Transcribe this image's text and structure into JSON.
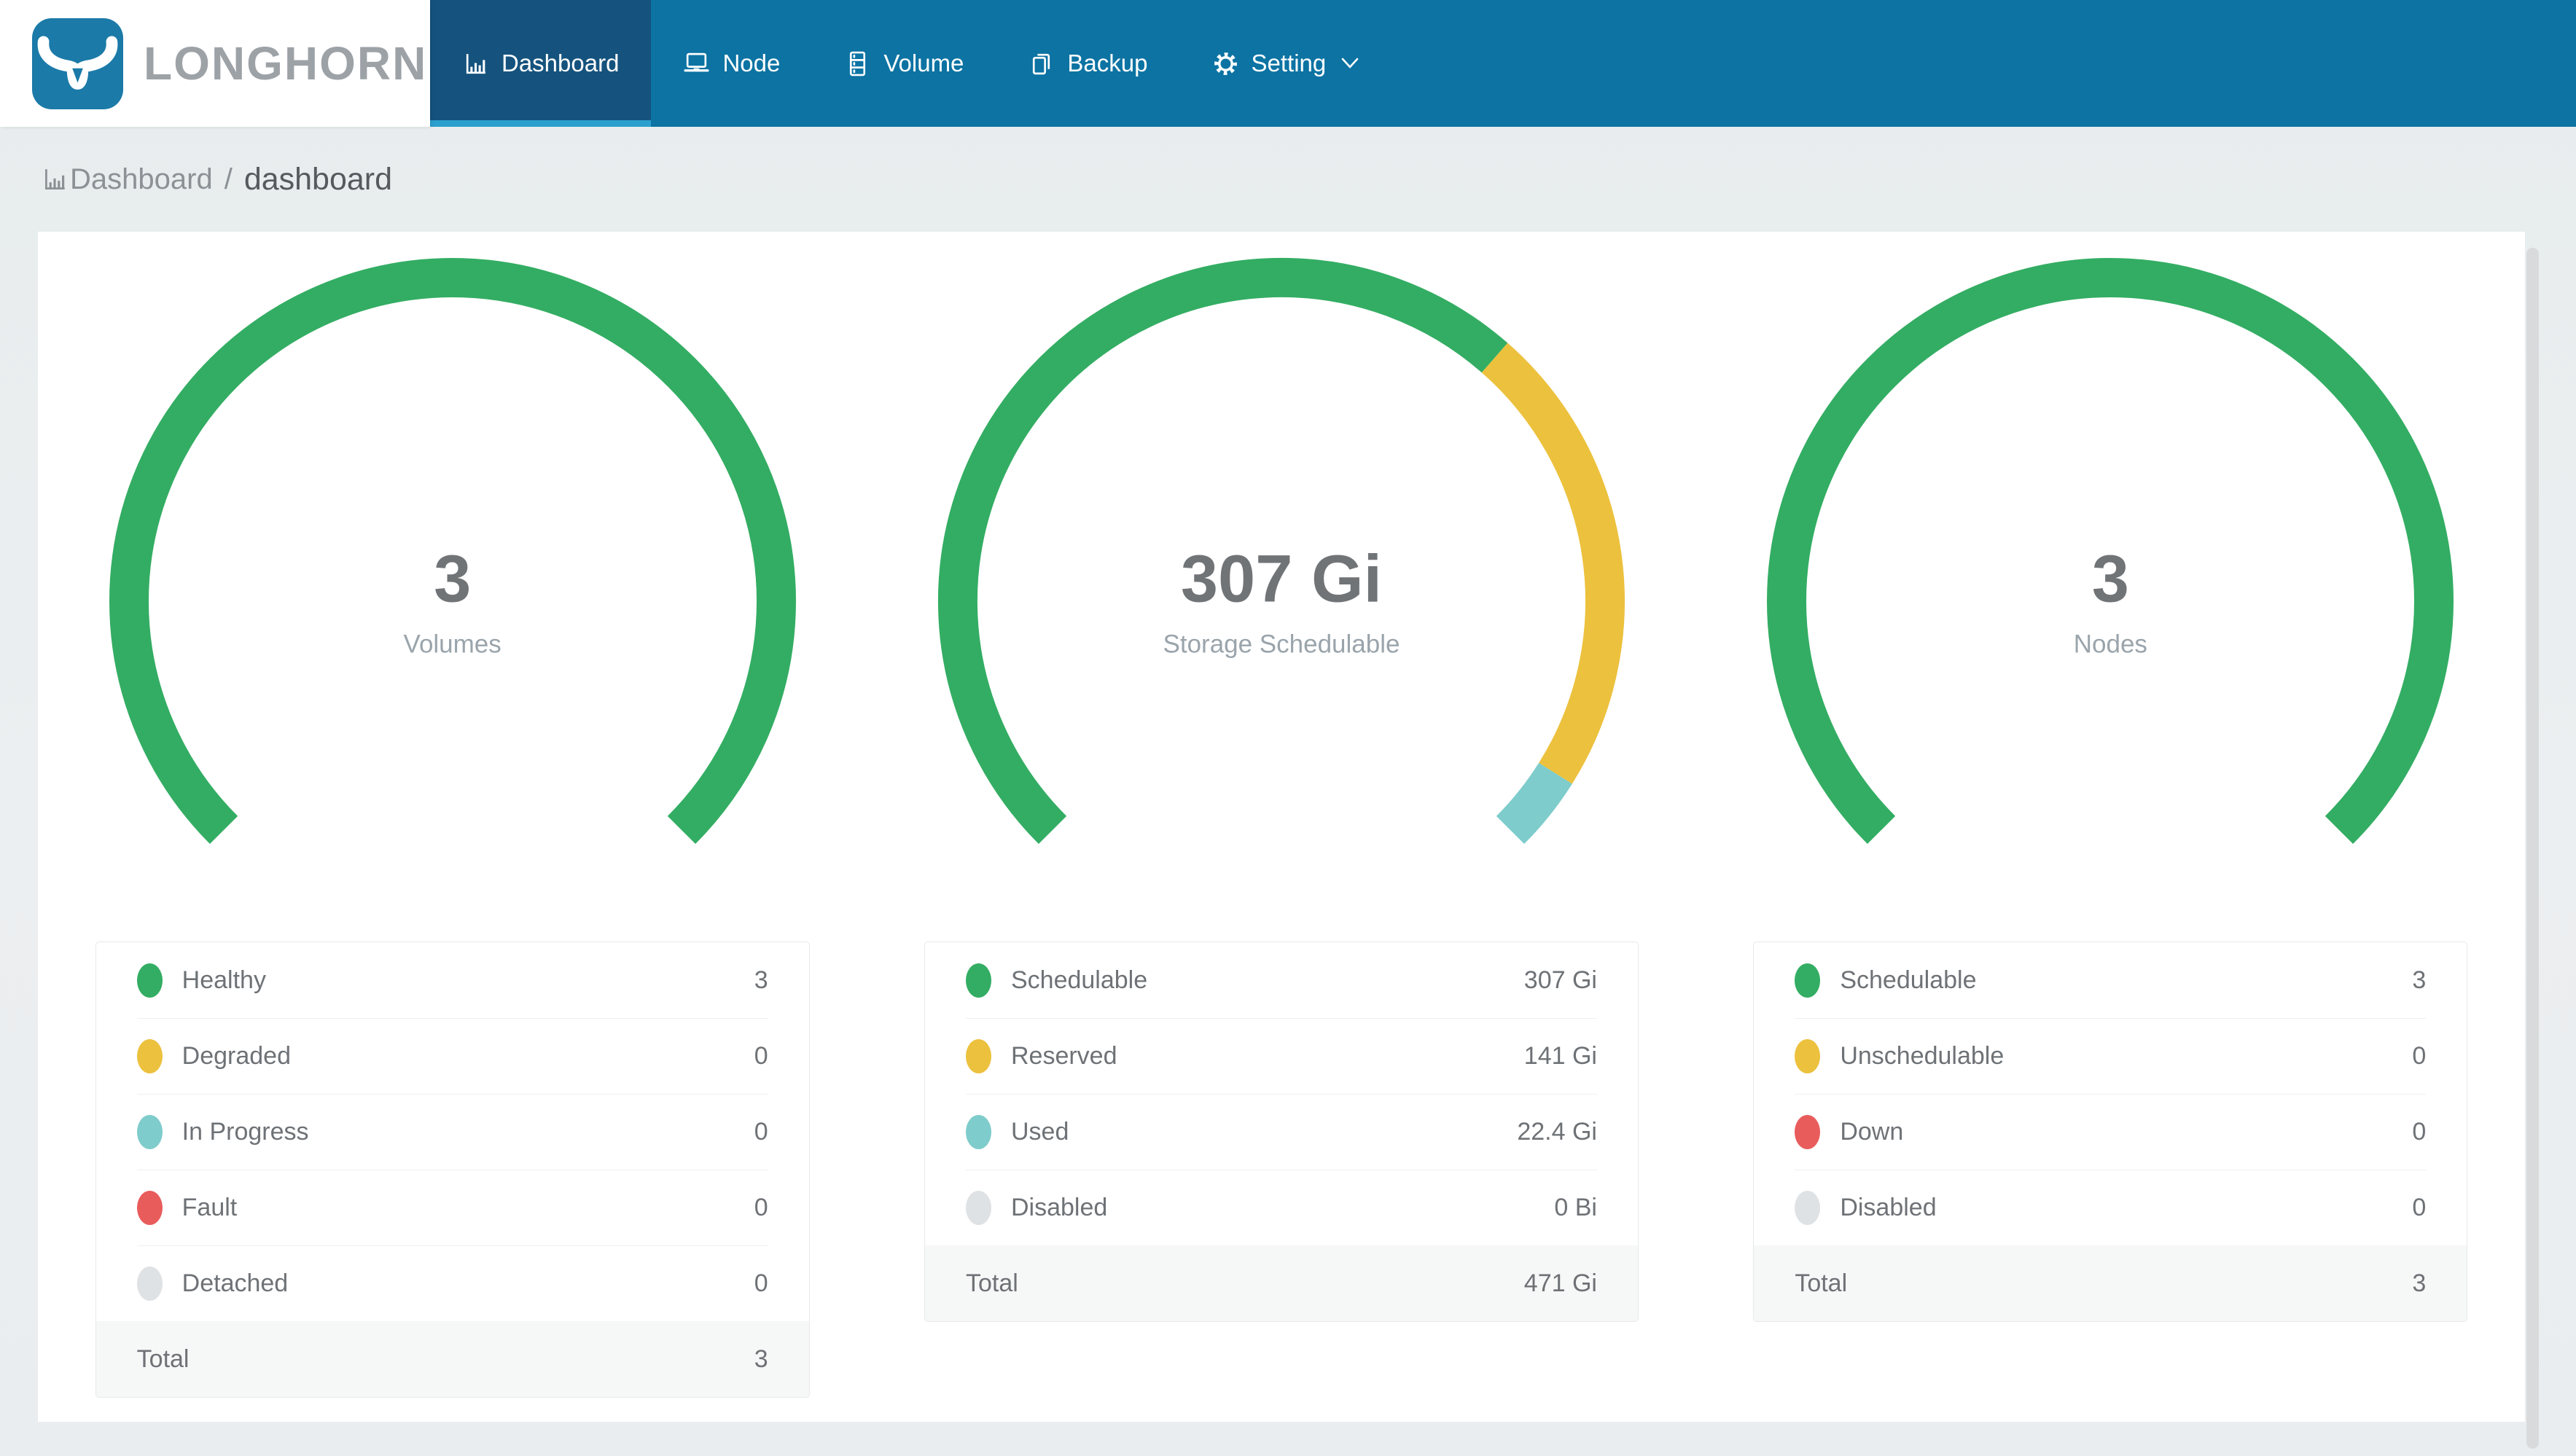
{
  "header": {
    "brand": "LONGHORN",
    "nav_items": [
      {
        "label": "Dashboard",
        "icon": "bar-chart-icon",
        "active": true
      },
      {
        "label": "Node",
        "icon": "laptop-icon",
        "active": false
      },
      {
        "label": "Volume",
        "icon": "server-icon",
        "active": false
      },
      {
        "label": "Backup",
        "icon": "copy-icon",
        "active": false
      },
      {
        "label": "Setting",
        "icon": "gear-icon",
        "active": false,
        "dropdown": true
      }
    ]
  },
  "breadcrumb": {
    "section": "Dashboard",
    "separator": "/",
    "page": "dashboard"
  },
  "panels": [
    {
      "id": "volumes",
      "center_value": "3",
      "center_label": "Volumes",
      "rows": [
        {
          "label": "Healthy",
          "value": "3",
          "color": "#33ad63"
        },
        {
          "label": "Degraded",
          "value": "0",
          "color": "#ecc13d"
        },
        {
          "label": "In Progress",
          "value": "0",
          "color": "#7ecccb"
        },
        {
          "label": "Fault",
          "value": "0",
          "color": "#e95c5c"
        },
        {
          "label": "Detached",
          "value": "0",
          "color": "#dfe2e4"
        }
      ],
      "total": {
        "label": "Total",
        "value": "3"
      },
      "ring": [
        {
          "color": "#33ad63",
          "value": 3
        },
        {
          "color": "#ecc13d",
          "value": 0
        },
        {
          "color": "#7ecccb",
          "value": 0
        },
        {
          "color": "#e95c5c",
          "value": 0
        },
        {
          "color": "#dfe2e4",
          "value": 0
        }
      ]
    },
    {
      "id": "storage",
      "center_value": "307 Gi",
      "center_label": "Storage Schedulable",
      "rows": [
        {
          "label": "Schedulable",
          "value": "307 Gi",
          "color": "#33ad63"
        },
        {
          "label": "Reserved",
          "value": "141 Gi",
          "color": "#ecc13d"
        },
        {
          "label": "Used",
          "value": "22.4 Gi",
          "color": "#7ecccb"
        },
        {
          "label": "Disabled",
          "value": "0 Bi",
          "color": "#dfe2e4"
        }
      ],
      "total": {
        "label": "Total",
        "value": "471 Gi"
      },
      "ring": [
        {
          "color": "#33ad63",
          "value": 307
        },
        {
          "color": "#ecc13d",
          "value": 141
        },
        {
          "color": "#7ecccb",
          "value": 22.4
        },
        {
          "color": "#dfe2e4",
          "value": 0
        }
      ]
    },
    {
      "id": "nodes",
      "center_value": "3",
      "center_label": "Nodes",
      "rows": [
        {
          "label": "Schedulable",
          "value": "3",
          "color": "#33ad63"
        },
        {
          "label": "Unschedulable",
          "value": "0",
          "color": "#ecc13d"
        },
        {
          "label": "Down",
          "value": "0",
          "color": "#e95c5c"
        },
        {
          "label": "Disabled",
          "value": "0",
          "color": "#dfe2e4"
        }
      ],
      "total": {
        "label": "Total",
        "value": "3"
      },
      "ring": [
        {
          "color": "#33ad63",
          "value": 3
        },
        {
          "color": "#ecc13d",
          "value": 0
        },
        {
          "color": "#e95c5c",
          "value": 0
        },
        {
          "color": "#dfe2e4",
          "value": 0
        }
      ]
    }
  ],
  "chart_data": [
    {
      "type": "gauge",
      "title": "Volumes",
      "center_text": "3",
      "center_label": "Volumes",
      "start_angle": 225,
      "end_angle": -45,
      "segments": [
        {
          "name": "Healthy",
          "value": 3,
          "color": "#33ad63"
        },
        {
          "name": "Degraded",
          "value": 0,
          "color": "#ecc13d"
        },
        {
          "name": "In Progress",
          "value": 0,
          "color": "#7ecccb"
        },
        {
          "name": "Fault",
          "value": 0,
          "color": "#e95c5c"
        },
        {
          "name": "Detached",
          "value": 0,
          "color": "#dfe2e4"
        }
      ],
      "total": 3
    },
    {
      "type": "gauge",
      "title": "Storage Schedulable",
      "center_text": "307 Gi",
      "center_label": "Storage Schedulable",
      "start_angle": 225,
      "end_angle": -45,
      "unit": "Gi",
      "segments": [
        {
          "name": "Schedulable",
          "value": 307,
          "color": "#33ad63"
        },
        {
          "name": "Reserved",
          "value": 141,
          "color": "#ecc13d"
        },
        {
          "name": "Used",
          "value": 22.4,
          "color": "#7ecccb"
        },
        {
          "name": "Disabled",
          "value": 0,
          "color": "#dfe2e4"
        }
      ],
      "total": 471
    },
    {
      "type": "gauge",
      "title": "Nodes",
      "center_text": "3",
      "center_label": "Nodes",
      "start_angle": 225,
      "end_angle": -45,
      "segments": [
        {
          "name": "Schedulable",
          "value": 3,
          "color": "#33ad63"
        },
        {
          "name": "Unschedulable",
          "value": 0,
          "color": "#ecc13d"
        },
        {
          "name": "Down",
          "value": 0,
          "color": "#e95c5c"
        },
        {
          "name": "Disabled",
          "value": 0,
          "color": "#dfe2e4"
        }
      ],
      "total": 3
    }
  ],
  "colors": {
    "navbar": "#0c73a3",
    "navbar_active": "#15537e",
    "active_underline": "#2ba0ce",
    "logo_blue": "#1b7aa8",
    "green": "#33ad63",
    "yellow": "#ecc13d",
    "teal": "#7ecccb",
    "red": "#e95c5c",
    "disabled_gray": "#dfe2e4",
    "page_background": "#eceff1",
    "card_background": "#ffffff"
  }
}
